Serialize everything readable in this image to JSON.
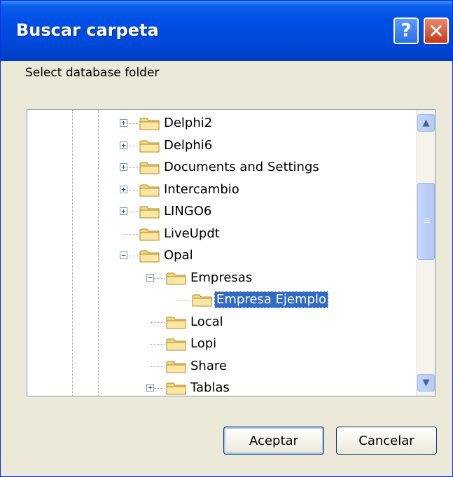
{
  "window": {
    "title": "Buscar carpeta",
    "help_glyph": "?",
    "close_glyph": "✕"
  },
  "prompt": "Select database folder",
  "tree": {
    "items": [
      {
        "label": "Delphi2",
        "expander": "+",
        "level": 2
      },
      {
        "label": "Delphi6",
        "expander": "+",
        "level": 2
      },
      {
        "label": "Documents and Settings",
        "expander": "+",
        "level": 2
      },
      {
        "label": "Intercambio",
        "expander": "+",
        "level": 2
      },
      {
        "label": "LINGO6",
        "expander": "+",
        "level": 2
      },
      {
        "label": "LiveUpdt",
        "expander": "",
        "level": 2
      },
      {
        "label": "Opal",
        "expander": "−",
        "level": 2
      },
      {
        "label": "Empresas",
        "expander": "−",
        "level": 3
      },
      {
        "label": "Empresa Ejemplo",
        "expander": "",
        "level": 4,
        "selected": true
      },
      {
        "label": "Local",
        "expander": "",
        "level": 3
      },
      {
        "label": "Lopi",
        "expander": "",
        "level": 3
      },
      {
        "label": "Share",
        "expander": "",
        "level": 3
      },
      {
        "label": "Tablas",
        "expander": "+",
        "level": 3
      }
    ]
  },
  "scrollbar": {
    "up_glyph": "▲",
    "down_glyph": "▼"
  },
  "buttons": {
    "ok": "Aceptar",
    "cancel": "Cancelar"
  },
  "colors": {
    "title_bar": "#0050e6",
    "selection": "#316ac5",
    "dialog_bg": "#ece9d8"
  }
}
